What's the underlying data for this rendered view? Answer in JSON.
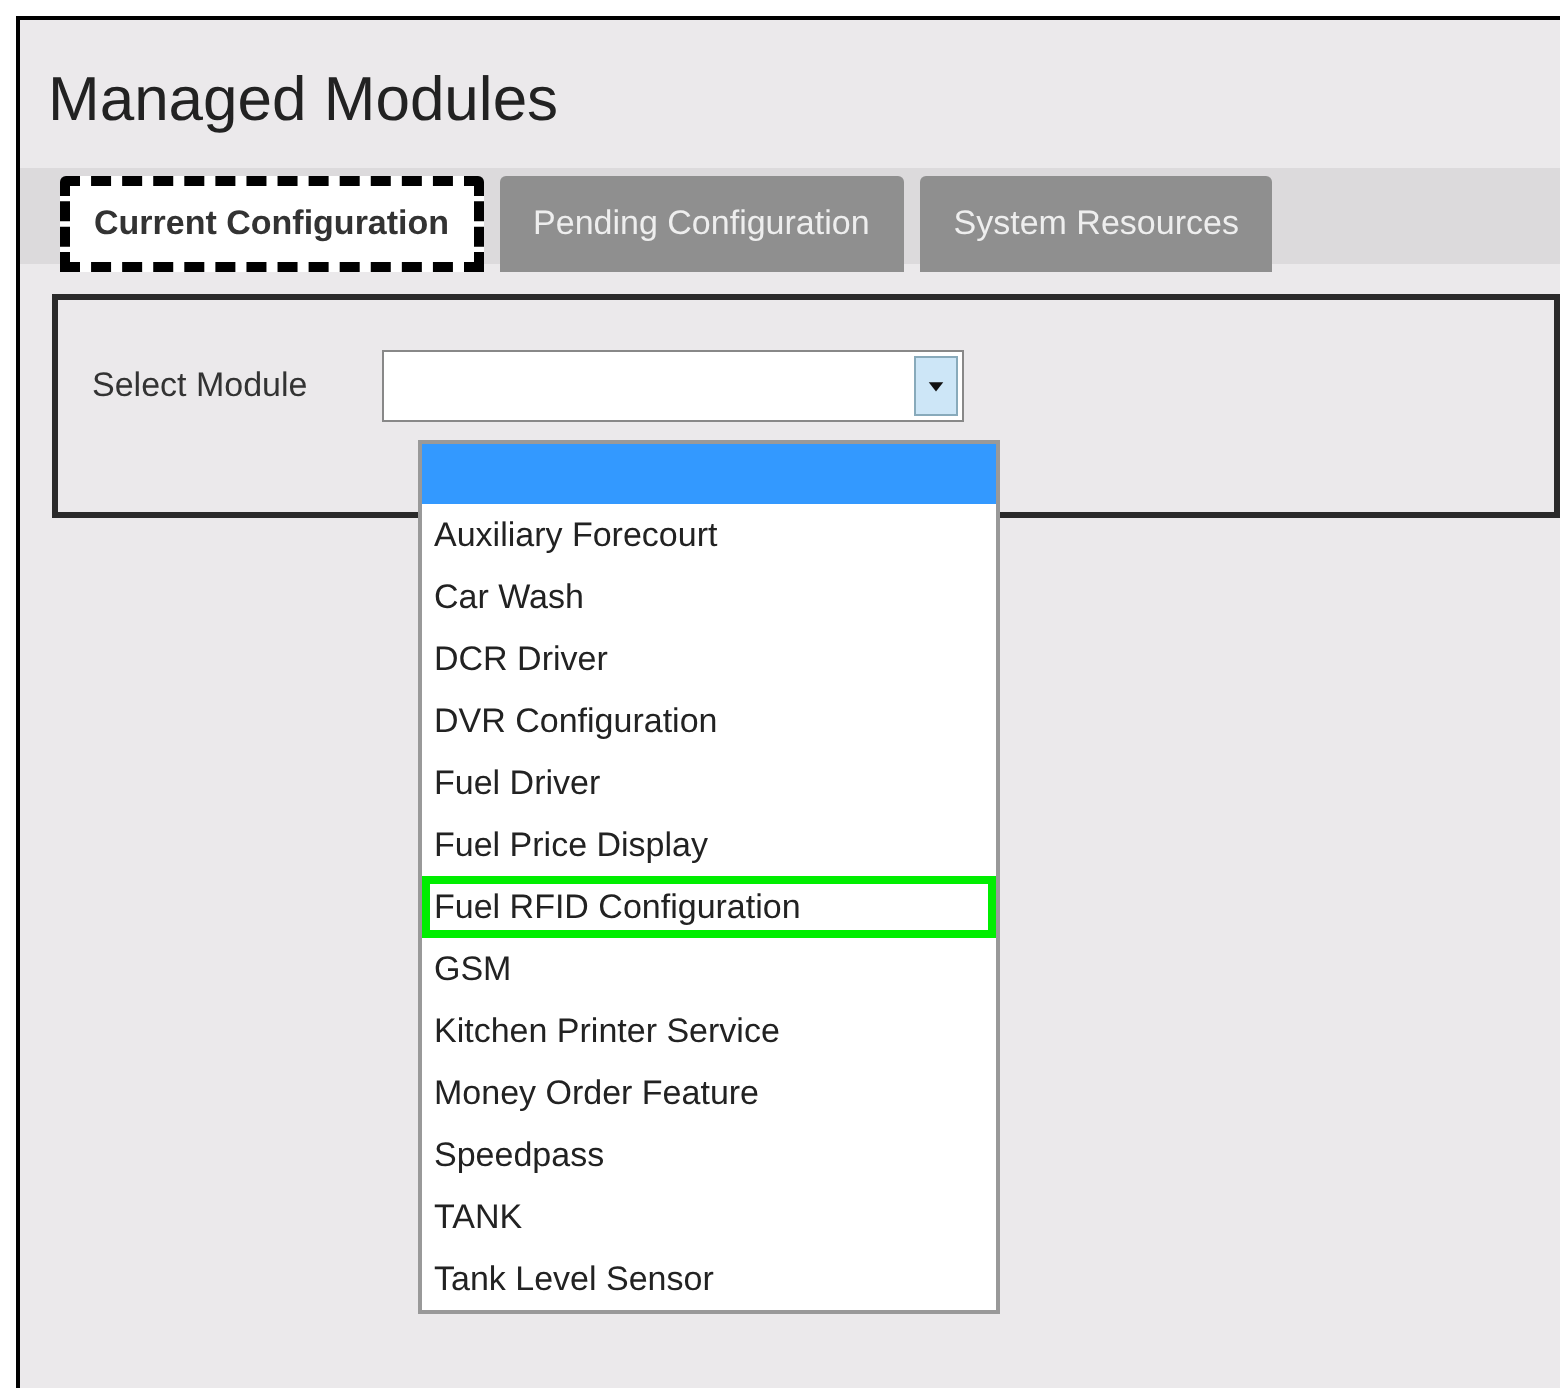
{
  "page": {
    "title": "Managed Modules"
  },
  "tabs": [
    {
      "label": "Current Configuration",
      "selected": true,
      "focused": true
    },
    {
      "label": "Pending Configuration",
      "selected": false,
      "focused": false
    },
    {
      "label": "System Resources",
      "selected": false,
      "focused": false
    }
  ],
  "select_module": {
    "label": "Select Module",
    "expanded": true,
    "options": [
      {
        "selected": true,
        "highlighted": false
      },
      {
        "label": "Auxiliary Forecourt",
        "selected": false,
        "highlighted": false
      },
      {
        "label": "Car Wash",
        "selected": false,
        "highlighted": false
      },
      {
        "label": "DCR Driver",
        "selected": false,
        "highlighted": false
      },
      {
        "label": "DVR Configuration",
        "selected": false,
        "highlighted": false
      },
      {
        "label": "Fuel Driver",
        "selected": false,
        "highlighted": false
      },
      {
        "label": "Fuel Price Display",
        "selected": false,
        "highlighted": false
      },
      {
        "label": "Fuel RFID Configuration",
        "selected": false,
        "highlighted": true
      },
      {
        "label": "GSM",
        "selected": false,
        "highlighted": false
      },
      {
        "label": "Kitchen Printer Service",
        "selected": false,
        "highlighted": false
      },
      {
        "label": "Money Order Feature",
        "selected": false,
        "highlighted": false
      },
      {
        "label": "Speedpass",
        "selected": false,
        "highlighted": false
      },
      {
        "label": "TANK",
        "selected": false,
        "highlighted": false
      },
      {
        "label": "Tank Level Sensor",
        "selected": false,
        "highlighted": false
      }
    ]
  }
}
